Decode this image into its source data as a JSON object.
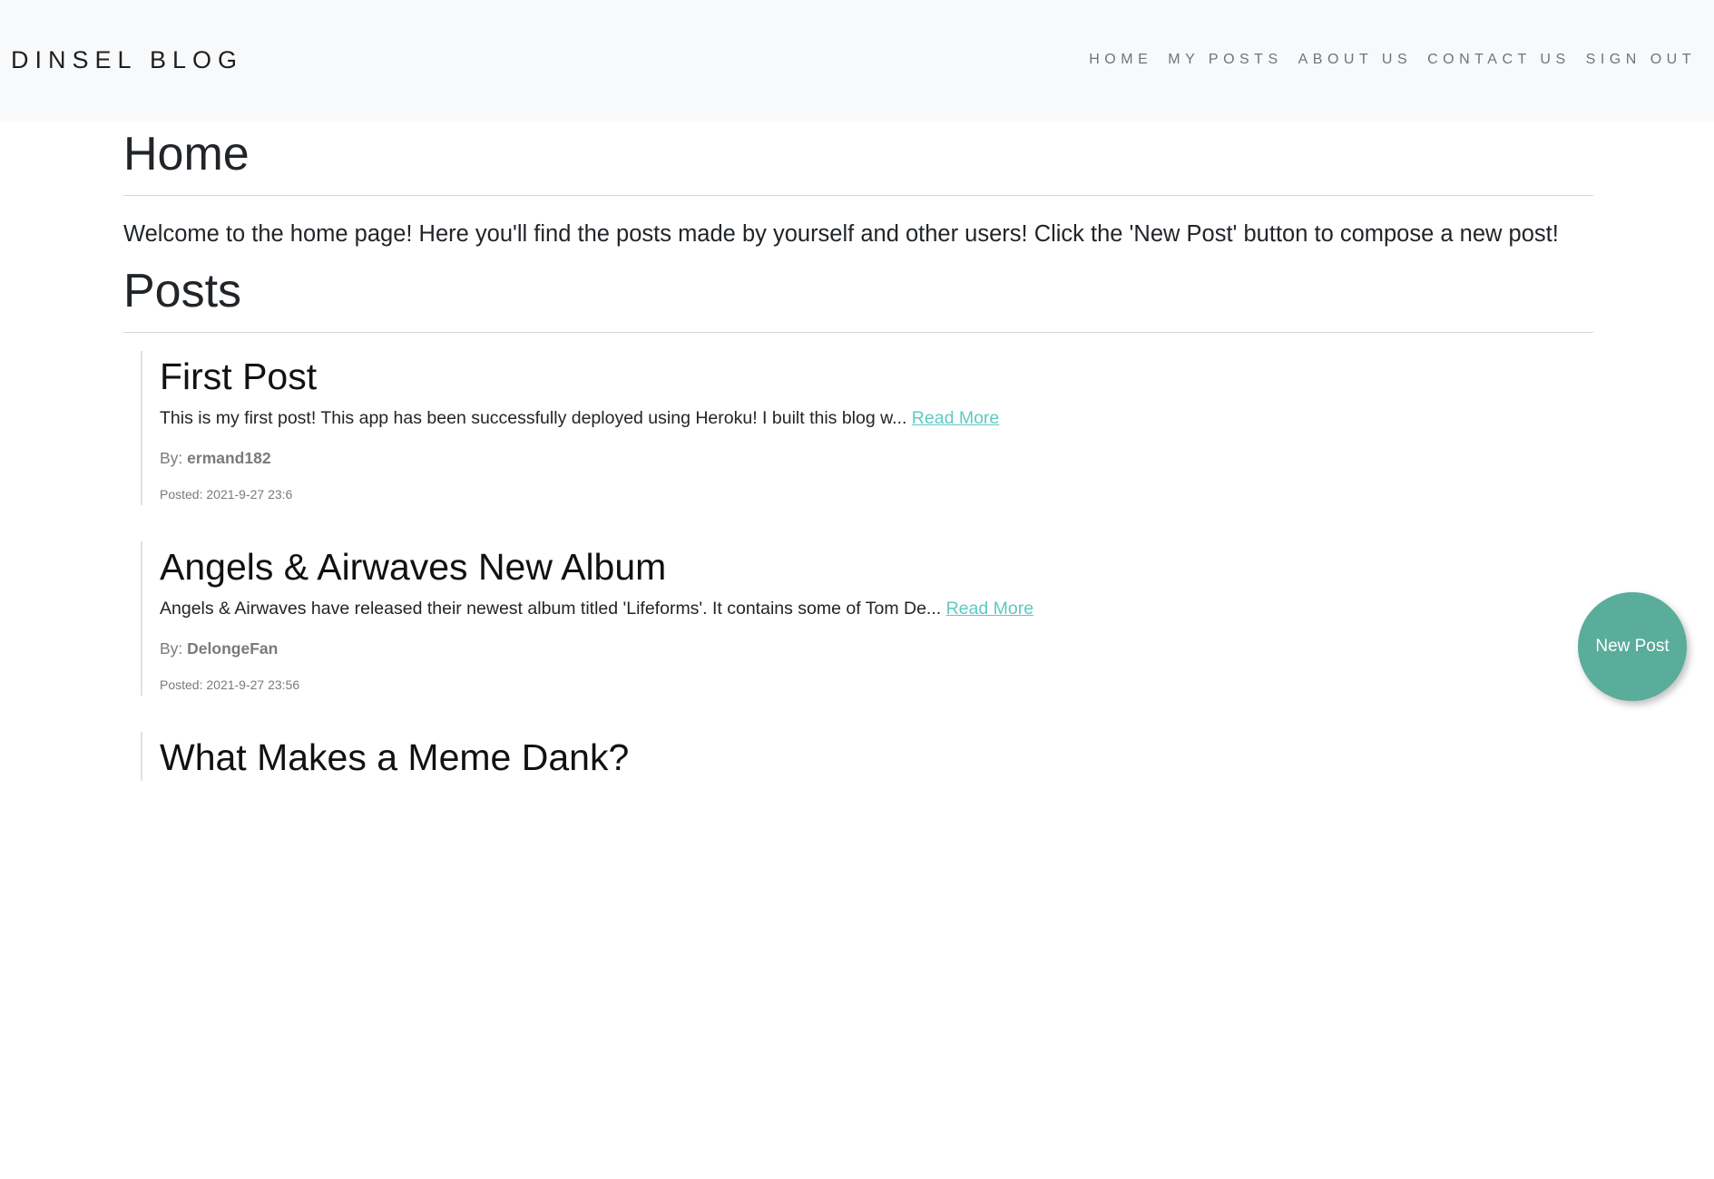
{
  "navbar": {
    "brand": "DINSEL BLOG",
    "links": [
      {
        "label": "HOME"
      },
      {
        "label": "MY POSTS"
      },
      {
        "label": "ABOUT US"
      },
      {
        "label": "CONTACT US"
      },
      {
        "label": "SIGN OUT"
      }
    ]
  },
  "main": {
    "title": "Home",
    "welcome": "Welcome to the home page! Here you'll find the posts made by yourself and other users! Click the 'New Post' button to compose a new post!",
    "posts_heading": "Posts"
  },
  "posts": [
    {
      "title": "First Post",
      "excerpt": "This is my first post! This app has been successfully deployed using Heroku! I built this blog w... ",
      "read_more": "Read More",
      "by_label": "By: ",
      "author": "ermand182",
      "posted": "Posted: 2021-9-27 23:6"
    },
    {
      "title": "Angels & Airwaves New Album",
      "excerpt": "Angels & Airwaves have released their newest album titled 'Lifeforms'. It contains some of Tom De... ",
      "read_more": "Read More",
      "by_label": "By: ",
      "author": "DelongeFan",
      "posted": "Posted: 2021-9-27 23:56"
    },
    {
      "title": "What Makes a Meme Dank?"
    }
  ],
  "new_post_button": "New Post",
  "colors": {
    "navbar_bg": "#f8f9fa",
    "link_accent": "#5fc9c2",
    "button_bg": "#5aac9b"
  }
}
